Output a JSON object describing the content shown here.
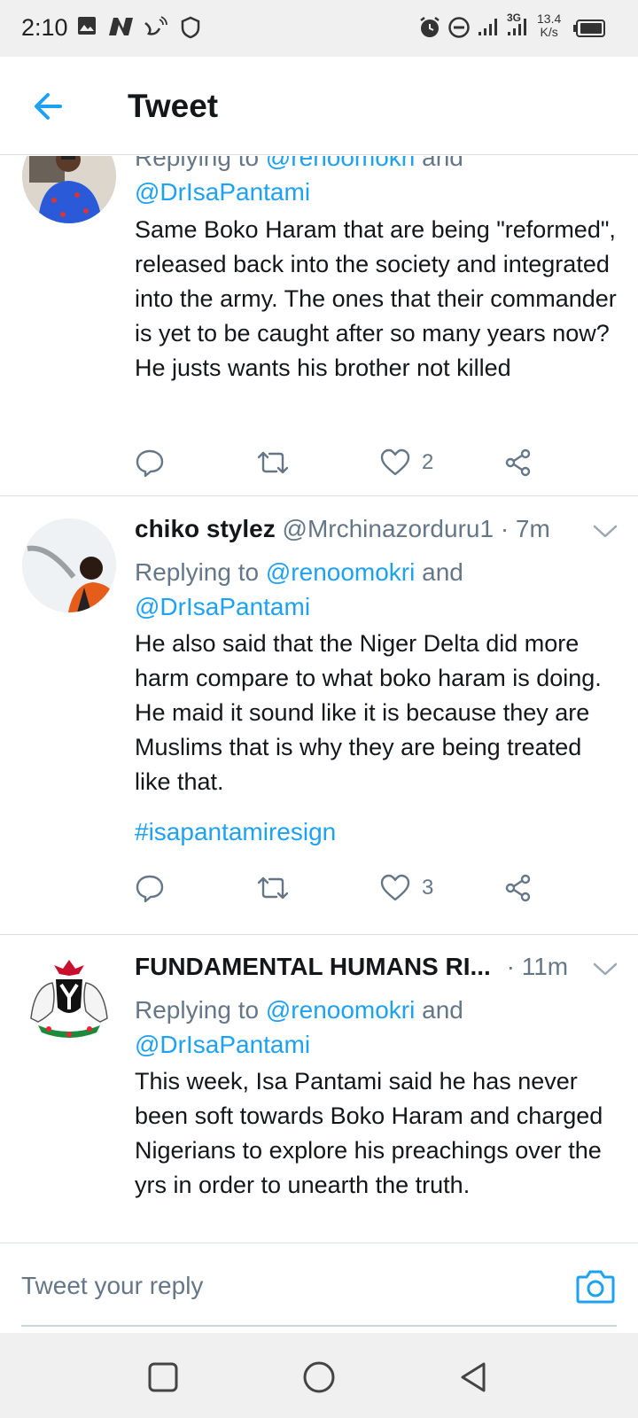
{
  "status_bar": {
    "time": "2:10",
    "speed_value": "13.4",
    "speed_unit": "K/s",
    "network": "3G",
    "icons": [
      "gallery-icon",
      "n-logo-icon",
      "wifi-call-icon",
      "shield-icon",
      "alarm-icon",
      "dnd-icon",
      "signal-icon",
      "battery-icon"
    ]
  },
  "app_bar": {
    "title": "Tweet"
  },
  "colors": {
    "accent": "#1da1f2",
    "secondary_text": "#657786",
    "primary_text": "#14171a",
    "divider": "#d8dee3"
  },
  "tweets": [
    {
      "name": "",
      "handle": "",
      "time": "",
      "replying_prefix": "Replying to ",
      "mention1": "@renoomokri",
      "and": " and",
      "mention2": "@DrIsaPantami",
      "body": "Same Boko Haram that are being \"reformed\", released back into the society and integrated into the army. The ones that their commander is yet to be caught after so many years now? He justs wants his brother not killed",
      "hashtag": "",
      "likes": "2"
    },
    {
      "name": "chiko stylez",
      "handle": "@Mrchinazorduru1",
      "time": "· 7m",
      "replying_prefix": "Replying to ",
      "mention1": "@renoomokri",
      "and": " and",
      "mention2": "@DrIsaPantami",
      "body": "He also said that the Niger Delta did more harm compare to what boko haram is doing. He maid it sound like it is because they are Muslims that is why they are being treated like that.",
      "hashtag": "#isapantamiresign",
      "likes": "3"
    },
    {
      "name": "FUNDAMENTAL HUMANS RI...",
      "handle": "",
      "time": "· 11m",
      "replying_prefix": "Replying to ",
      "mention1": "@renoomokri",
      "and": " and",
      "mention2": "@DrIsaPantami",
      "body": "This week, Isa Pantami said he has never been soft towards Boko Haram and charged Nigerians to explore his preachings over the yrs in order to unearth the truth.",
      "hashtag": "",
      "likes": ""
    }
  ],
  "reply_bar": {
    "placeholder": "Tweet your reply"
  }
}
